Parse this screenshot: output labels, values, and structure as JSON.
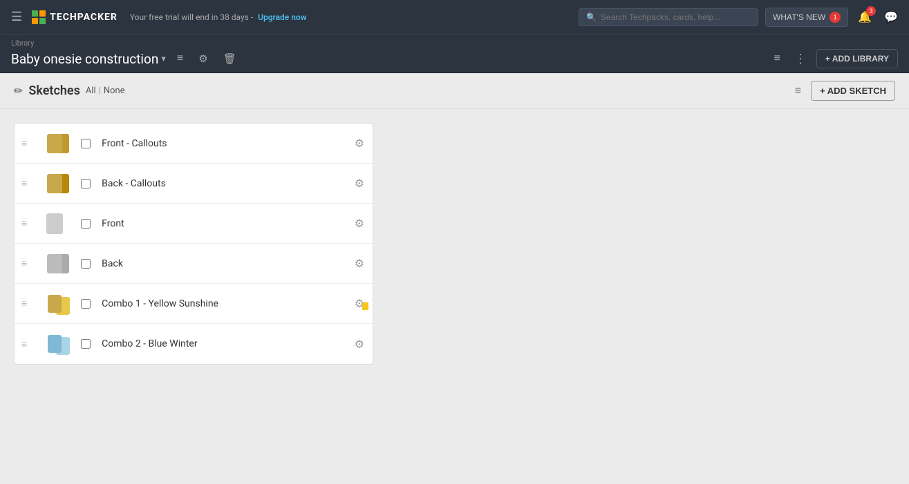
{
  "nav": {
    "hamburger": "☰",
    "logo_text": "TECHPACKER",
    "trial_text": "Your free trial will end in 38 days -",
    "upgrade_label": "Upgrade now",
    "search_placeholder": "Search Techpacks, cards, help...",
    "whats_new_label": "WHAT'S NEW",
    "whats_new_badge": "1",
    "notifications_badge": "3",
    "bell_icon": "🔔",
    "chat_icon": "💬"
  },
  "library_bar": {
    "breadcrumb": "Library",
    "title": "Baby onesie construction",
    "chevron": "▾",
    "sort_icon": "≡",
    "gear_icon": "⚙",
    "delete_icon": "🗑",
    "filter_icon": "≡",
    "more_icon": "⋮",
    "add_library_label": "+ ADD LIBRARY"
  },
  "sketches": {
    "pencil": "✏",
    "title": "Sketches",
    "filter_all": "All",
    "filter_sep": "|",
    "filter_none": "None",
    "filter_icon": "≡",
    "add_sketch_label": "+ ADD SKETCH",
    "rows": [
      {
        "id": 1,
        "name": "Front - Callouts",
        "thumb_type": "double_yellow",
        "has_badge": false
      },
      {
        "id": 2,
        "name": "Back - Callouts",
        "thumb_type": "double_yellow",
        "has_badge": false
      },
      {
        "id": 3,
        "name": "Front",
        "thumb_type": "single_gray",
        "has_badge": false
      },
      {
        "id": 4,
        "name": "Back",
        "thumb_type": "single_gray",
        "has_badge": false
      },
      {
        "id": 5,
        "name": "Combo 1 - Yellow Sunshine",
        "thumb_type": "double_yellow_small",
        "has_badge": true
      },
      {
        "id": 6,
        "name": "Combo 2 - Blue Winter",
        "thumb_type": "double_blue",
        "has_badge": false
      }
    ]
  }
}
